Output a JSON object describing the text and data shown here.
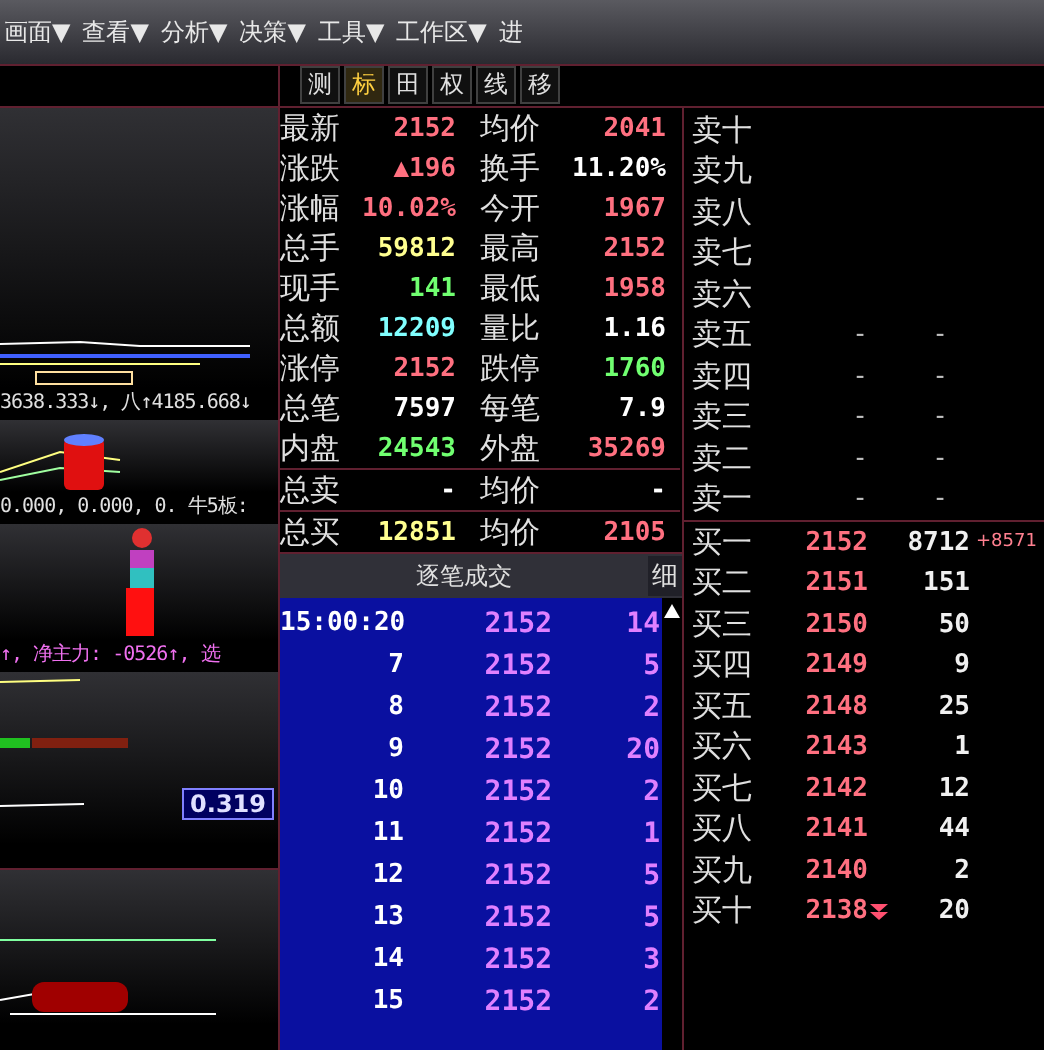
{
  "menu": [
    "画面▼",
    "查看▼",
    "分析▼",
    "决策▼",
    "工具▼",
    "工作区▼",
    "进"
  ],
  "tools": [
    {
      "label": "测",
      "selected": false
    },
    {
      "label": "标",
      "selected": true
    },
    {
      "label": "田",
      "selected": false
    },
    {
      "label": "权",
      "selected": false
    },
    {
      "label": "线",
      "selected": false
    },
    {
      "label": "移",
      "selected": false
    }
  ],
  "chart_texts": {
    "ma_line": "3638.333↓, 八↑4185.668↓",
    "indicator_line": "0.000, 0.000, 0. 牛5板:",
    "flow_line": "↑, 净主力: -0526↑, 选",
    "reading": "0.319"
  },
  "quote": [
    {
      "label": "最新",
      "value": "2152",
      "color": "#ff7080"
    },
    {
      "label": "均价",
      "value": "2041",
      "color": "#ff7080"
    },
    {
      "label": "涨跌",
      "value": "▲196",
      "color": "#ff7080"
    },
    {
      "label": "换手",
      "value": "11.20%",
      "color": "#ffffff"
    },
    {
      "label": "涨幅",
      "value": "10.02%",
      "color": "#ff7080"
    },
    {
      "label": "今开",
      "value": "1967",
      "color": "#ff7080"
    },
    {
      "label": "总手",
      "value": "59812",
      "color": "#ffff90"
    },
    {
      "label": "最高",
      "value": "2152",
      "color": "#ff7080"
    },
    {
      "label": "现手",
      "value": "141",
      "color": "#70ff70"
    },
    {
      "label": "最低",
      "value": "1958",
      "color": "#ff7080"
    },
    {
      "label": "总额",
      "value": "12209",
      "color": "#80ffff"
    },
    {
      "label": "量比",
      "value": "1.16",
      "color": "#ffffff"
    },
    {
      "label": "涨停",
      "value": "2152",
      "color": "#ff7080"
    },
    {
      "label": "跌停",
      "value": "1760",
      "color": "#70ff70"
    },
    {
      "label": "总笔",
      "value": "7597",
      "color": "#ffffff"
    },
    {
      "label": "每笔",
      "value": "7.9",
      "color": "#ffffff"
    },
    {
      "label": "内盘",
      "value": "24543",
      "color": "#70ff70"
    },
    {
      "label": "外盘",
      "value": "35269",
      "color": "#ff7080"
    },
    {
      "label": "总卖",
      "value": "-",
      "color": "#ffffff"
    },
    {
      "label": "均价",
      "value": "-",
      "color": "#ffffff"
    },
    {
      "label": "总买",
      "value": "12851",
      "color": "#ffff90"
    },
    {
      "label": "均价",
      "value": "2105",
      "color": "#ff7080"
    }
  ],
  "ticks": {
    "title": "逐笔成交",
    "detail_button": "细",
    "rows": [
      {
        "time": "15:00:20",
        "price": "2152",
        "volume": "14"
      },
      {
        "time": "7",
        "price": "2152",
        "volume": "5"
      },
      {
        "time": "8",
        "price": "2152",
        "volume": "2"
      },
      {
        "time": "9",
        "price": "2152",
        "volume": "20"
      },
      {
        "time": "10",
        "price": "2152",
        "volume": "2"
      },
      {
        "time": "11",
        "price": "2152",
        "volume": "1"
      },
      {
        "time": "12",
        "price": "2152",
        "volume": "5"
      },
      {
        "time": "13",
        "price": "2152",
        "volume": "5"
      },
      {
        "time": "14",
        "price": "2152",
        "volume": "3"
      },
      {
        "time": "15",
        "price": "2152",
        "volume": "2"
      }
    ]
  },
  "asks": [
    {
      "label": "卖十"
    },
    {
      "label": "卖九"
    },
    {
      "label": "卖八"
    },
    {
      "label": "卖七"
    },
    {
      "label": "卖六"
    },
    {
      "label": "卖五",
      "price": "-",
      "volume": "-"
    },
    {
      "label": "卖四",
      "price": "-",
      "volume": "-"
    },
    {
      "label": "卖三",
      "price": "-",
      "volume": "-"
    },
    {
      "label": "卖二",
      "price": "-",
      "volume": "-"
    },
    {
      "label": "卖一",
      "price": "-",
      "volume": "-"
    }
  ],
  "bids": [
    {
      "label": "买一",
      "price": "2152",
      "volume": "8712",
      "change": "+8571",
      "down": false
    },
    {
      "label": "买二",
      "price": "2151",
      "volume": "151",
      "down": false
    },
    {
      "label": "买三",
      "price": "2150",
      "volume": "50",
      "down": false
    },
    {
      "label": "买四",
      "price": "2149",
      "volume": "9",
      "down": false
    },
    {
      "label": "买五",
      "price": "2148",
      "volume": "25",
      "down": false
    },
    {
      "label": "买六",
      "price": "2143",
      "volume": "1",
      "down": false
    },
    {
      "label": "买七",
      "price": "2142",
      "volume": "12",
      "down": false
    },
    {
      "label": "买八",
      "price": "2141",
      "volume": "44",
      "down": false
    },
    {
      "label": "买九",
      "price": "2140",
      "volume": "2",
      "down": false
    },
    {
      "label": "买十",
      "price": "2138",
      "volume": "20",
      "down": true
    }
  ]
}
